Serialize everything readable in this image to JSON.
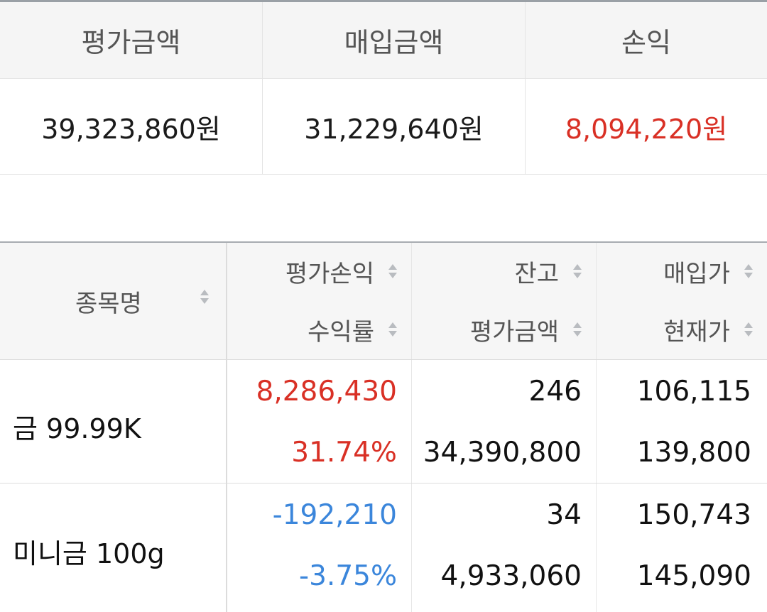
{
  "summary": {
    "headers": [
      "평가금액",
      "매입금액",
      "손익"
    ],
    "values": [
      "39,323,860원",
      "31,229,640원",
      "8,094,220원"
    ]
  },
  "holdings": {
    "headers": {
      "name": "종목명",
      "profit_loss": "평가손익",
      "return_rate": "수익률",
      "quantity": "잔고",
      "eval_amount": "평가금액",
      "buy_price": "매입가",
      "current_price": "현재가"
    },
    "rows": [
      {
        "name": "금 99.99K",
        "profit_loss": "8,286,430",
        "return_rate": "31.74%",
        "quantity": "246",
        "eval_amount": "34,390,800",
        "buy_price": "106,115",
        "current_price": "139,800"
      },
      {
        "name": "미니금 100g",
        "profit_loss": "-192,210",
        "return_rate": "-3.75%",
        "quantity": "34",
        "eval_amount": "4,933,060",
        "buy_price": "150,743",
        "current_price": "145,090"
      }
    ]
  },
  "colors": {
    "profit": "#d93025",
    "loss": "#3b86db",
    "sort_icon": "#b9bcc0"
  },
  "icons": {
    "sort": "sort-updown-icon"
  }
}
